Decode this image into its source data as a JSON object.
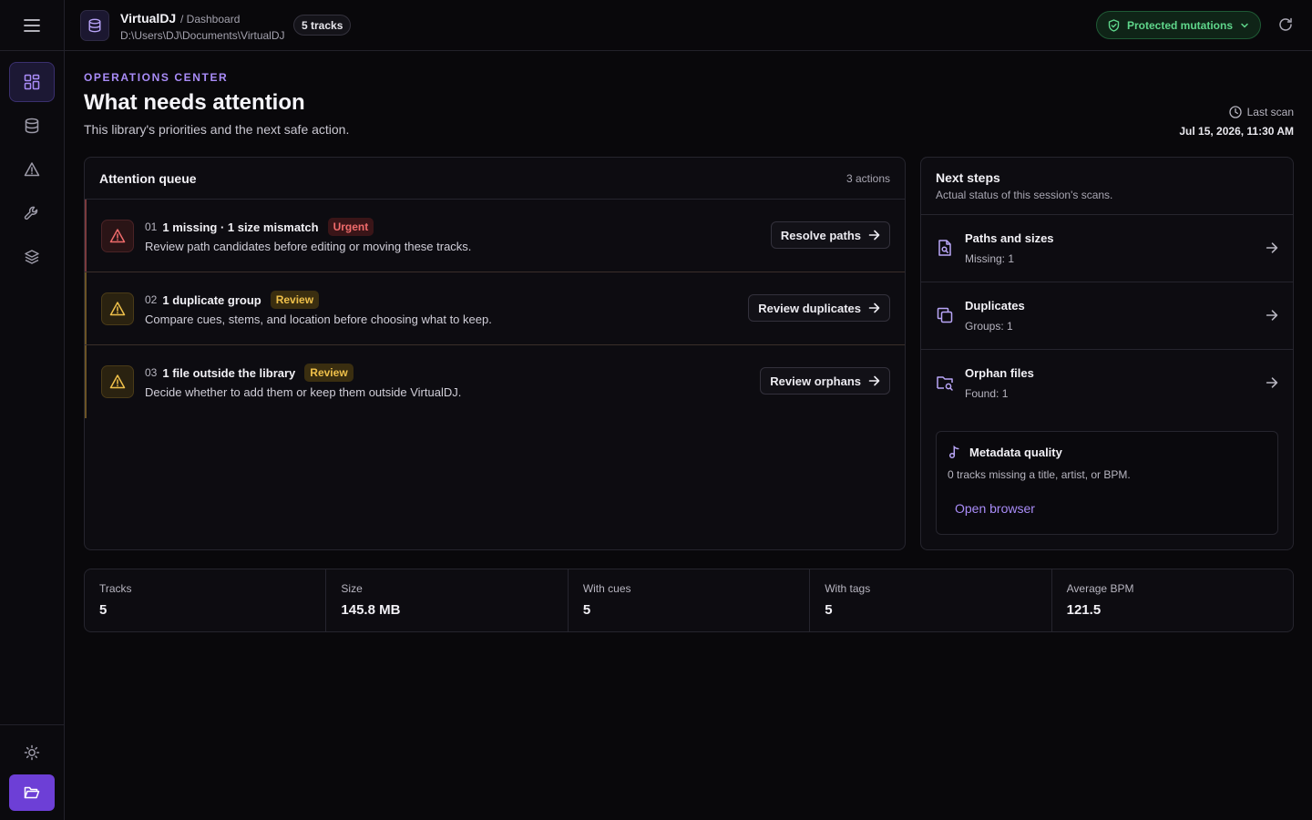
{
  "header": {
    "app_name": "VirtualDJ",
    "breadcrumb": "/ Dashboard",
    "path": "D:\\Users\\DJ\\Documents\\VirtualDJ",
    "tracks_badge": "5 tracks",
    "protected_label": "Protected mutations"
  },
  "page": {
    "eyebrow": "OPERATIONS CENTER",
    "title": "What needs attention",
    "subtitle": "This library's priorities and the next safe action.",
    "last_scan_label": "Last scan",
    "last_scan_date": "Jul 15, 2026, 11:30 AM"
  },
  "queue": {
    "title": "Attention queue",
    "count": "3 actions",
    "items": [
      {
        "num": "01",
        "title": "1 missing · 1 size mismatch",
        "badge": "Urgent",
        "desc": "Review path candidates before editing or moving these tracks.",
        "action": "Resolve paths"
      },
      {
        "num": "02",
        "title": "1 duplicate group",
        "badge": "Review",
        "desc": "Compare cues, stems, and location before choosing what to keep.",
        "action": "Review duplicates"
      },
      {
        "num": "03",
        "title": "1 file outside the library",
        "badge": "Review",
        "desc": "Decide whether to add them or keep them outside VirtualDJ.",
        "action": "Review orphans"
      }
    ]
  },
  "next_steps": {
    "title": "Next steps",
    "subtitle": "Actual status of this session's scans.",
    "items": [
      {
        "title": "Paths and sizes",
        "value": "Missing: 1"
      },
      {
        "title": "Duplicates",
        "value": "Groups: 1"
      },
      {
        "title": "Orphan files",
        "value": "Found: 1"
      }
    ],
    "metadata": {
      "title": "Metadata quality",
      "desc": "0 tracks missing a title, artist, or BPM.",
      "link": "Open browser"
    }
  },
  "stats": [
    {
      "label": "Tracks",
      "value": "5"
    },
    {
      "label": "Size",
      "value": "145.8 MB"
    },
    {
      "label": "With cues",
      "value": "5"
    },
    {
      "label": "With tags",
      "value": "5"
    },
    {
      "label": "Average BPM",
      "value": "121.5"
    }
  ],
  "colors": {
    "accent": "#a98cf8",
    "urgent": "#f06b6b",
    "review": "#efc04a",
    "protected": "#5fd68b"
  }
}
